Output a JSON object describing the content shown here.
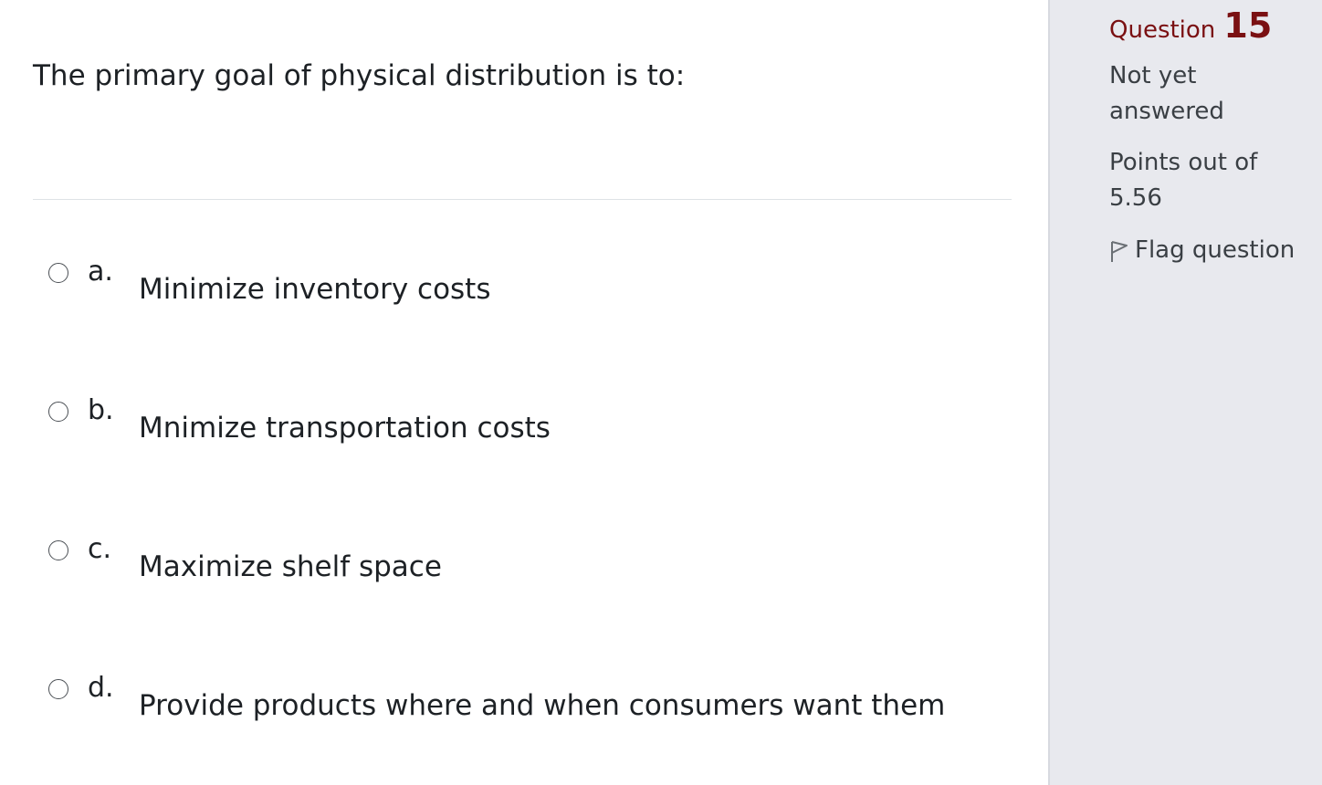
{
  "question": {
    "text": "The primary goal of physical distribution is to:",
    "options": [
      {
        "letter": "a.",
        "label": "Minimize inventory costs"
      },
      {
        "letter": "b.",
        "label": "Mnimize transportation costs"
      },
      {
        "letter": "c.",
        "label": "Maximize shelf space"
      },
      {
        "letter": "d.",
        "label": "Provide products where and when consumers want them"
      }
    ]
  },
  "info": {
    "question_word": "Question",
    "question_number": "15",
    "state": "Not yet answered",
    "grade": "Points out of 5.56",
    "flag_label": "Flag question",
    "flag_icon": "flag-outline-icon"
  },
  "colors": {
    "question_number": "#7a1012",
    "info_background": "#e8e9ee"
  }
}
